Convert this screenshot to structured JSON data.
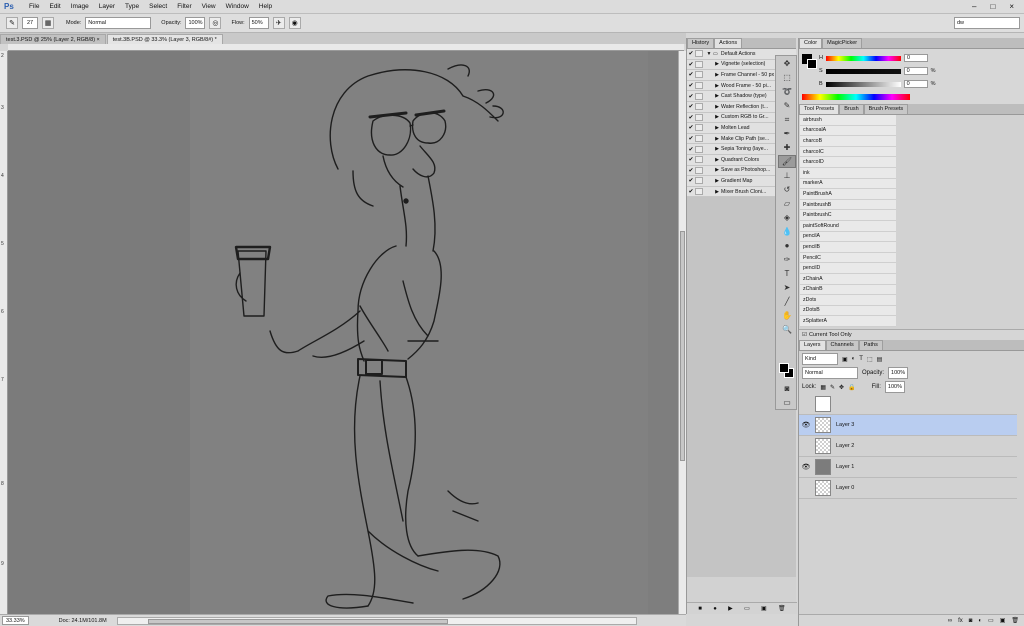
{
  "app": {
    "logo": "Ps"
  },
  "menu": [
    "File",
    "Edit",
    "Image",
    "Layer",
    "Type",
    "Select",
    "Filter",
    "View",
    "Window",
    "Help"
  ],
  "options": {
    "brush_size": "27",
    "mode_label": "Mode:",
    "mode_value": "Normal",
    "opacity_label": "Opacity:",
    "opacity_value": "100%",
    "flow_label": "Flow:",
    "flow_value": "50%",
    "workspace": "dw"
  },
  "tabs": [
    {
      "label": "test.3.PSD @ 25% (Layer 2, RGB/8) ×"
    },
    {
      "label": "test.3B.PSD @ 33.3% (Layer 3, RGB/8#) *",
      "active": true
    }
  ],
  "ruler_left": [
    "2",
    "3",
    "4",
    "5",
    "6",
    "7",
    "8",
    "9"
  ],
  "status": {
    "zoom": "33.33%",
    "doc": "Doc: 24.1M/101.8M"
  },
  "actions_panel": {
    "tabs": [
      "History",
      "Actions"
    ],
    "items": [
      "Default Actions",
      "Vignette (selection)",
      "Frame Channel - 50 px",
      "Wood Frame - 50 pi...",
      "Cast Shadow (type)",
      "Water Reflection (t...",
      "Custom RGB to Gr...",
      "Molten Lead",
      "Make Clip Path (se...",
      "Sepia Toning (laye...",
      "Quadrant Colors",
      "Save as Photoshop...",
      "Gradient Map",
      "Mixer Brush Cloni..."
    ]
  },
  "color_panel": {
    "tabs": [
      "Color",
      "MagicPicker"
    ],
    "rows": [
      {
        "label": "H",
        "value": "0",
        "unit": ""
      },
      {
        "label": "S",
        "value": "0",
        "unit": "%"
      },
      {
        "label": "B",
        "value": "0",
        "unit": "%"
      }
    ]
  },
  "presets_panel": {
    "tabs": [
      "Tool Presets",
      "Brush",
      "Brush Presets"
    ],
    "items": [
      "airbrush",
      "charcoalA",
      "charcoB",
      "charcoIC",
      "charcoID",
      "ink",
      "markerA",
      "PaintBrushA",
      "PaintbrushB",
      "PaintbrushC",
      "paintSoftRound",
      "pencilA",
      "pencilB",
      "PencilC",
      "pencilD",
      "zChainA",
      "zChainB",
      "zDots",
      "zDotsB",
      "zSplatterA"
    ],
    "current_only": "Current Tool Only"
  },
  "layers_panel": {
    "tabs": [
      "Layers",
      "Channels",
      "Paths"
    ],
    "filter": "Kind",
    "blend_mode": "Normal",
    "opacity_label": "Opacity:",
    "opacity_value": "100%",
    "lock_label": "Lock:",
    "fill_label": "Fill:",
    "fill_value": "100%",
    "layers": [
      {
        "name": "",
        "visible": false,
        "thumb": "white"
      },
      {
        "name": "Layer 3",
        "visible": true,
        "selected": true,
        "thumb": "check"
      },
      {
        "name": "Layer 2",
        "visible": false,
        "thumb": "check"
      },
      {
        "name": "Layer 1",
        "visible": true,
        "thumb": "filled"
      },
      {
        "name": "Layer 0",
        "visible": false,
        "thumb": "check"
      }
    ]
  }
}
